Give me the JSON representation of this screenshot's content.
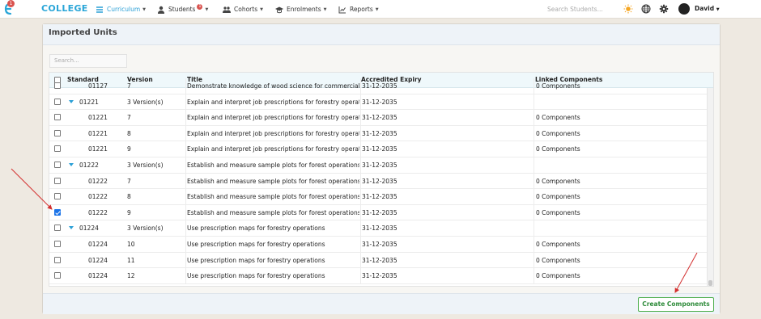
{
  "nav": {
    "brand": "COLLEGE",
    "logo_badge": "1",
    "items": [
      {
        "label": "Curriculum",
        "icon": "list-icon",
        "active": true
      },
      {
        "label": "Students",
        "icon": "user-icon",
        "badge": "1"
      },
      {
        "label": "Cohorts",
        "icon": "group-icon"
      },
      {
        "label": "Enrolments",
        "icon": "graduation-cap-icon"
      },
      {
        "label": "Reports",
        "icon": "chart-line-icon"
      }
    ],
    "search_placeholder": "Search Students...",
    "user": "David",
    "accent_color": "#2aa6d8"
  },
  "panel": {
    "title": "Imported Units",
    "search_placeholder": "Search...",
    "columns": [
      "Standard",
      "Version",
      "Title",
      "Accredited Expiry",
      "Linked Components"
    ],
    "rows": [
      {
        "type": "child",
        "standard": "01127",
        "version": "7",
        "title": "Demonstrate knowledge of wood science for commercial",
        "expiry": "31-12-2035",
        "linked": "0 Components",
        "checked": false,
        "partial": true
      },
      {
        "type": "group",
        "standard": "01221",
        "version": "3 Version(s)",
        "title": "Explain and interpret job prescriptions for forestry operations",
        "expiry": "31-12-2035",
        "linked": "",
        "checked": false
      },
      {
        "type": "child",
        "standard": "01221",
        "version": "7",
        "title": "Explain and interpret job prescriptions for forestry operations",
        "expiry": "31-12-2035",
        "linked": "0 Components",
        "checked": false
      },
      {
        "type": "child",
        "standard": "01221",
        "version": "8",
        "title": "Explain and interpret job prescriptions for forestry operations",
        "expiry": "31-12-2035",
        "linked": "0 Components",
        "checked": false
      },
      {
        "type": "child",
        "standard": "01221",
        "version": "9",
        "title": "Explain and interpret job prescriptions for forestry operations",
        "expiry": "31-12-2035",
        "linked": "0 Components",
        "checked": false
      },
      {
        "type": "group",
        "standard": "01222",
        "version": "3 Version(s)",
        "title": "Establish and measure sample plots for forest operations",
        "expiry": "31-12-2035",
        "linked": "",
        "checked": false
      },
      {
        "type": "child",
        "standard": "01222",
        "version": "7",
        "title": "Establish and measure sample plots for forest operations",
        "expiry": "31-12-2035",
        "linked": "0 Components",
        "checked": false
      },
      {
        "type": "child",
        "standard": "01222",
        "version": "8",
        "title": "Establish and measure sample plots for forest operations",
        "expiry": "31-12-2035",
        "linked": "0 Components",
        "checked": false
      },
      {
        "type": "child",
        "standard": "01222",
        "version": "9",
        "title": "Establish and measure sample plots for forest operations",
        "expiry": "31-12-2035",
        "linked": "0 Components",
        "checked": true
      },
      {
        "type": "group",
        "standard": "01224",
        "version": "3 Version(s)",
        "title": "Use prescription maps for forestry operations",
        "expiry": "31-12-2035",
        "linked": "",
        "checked": false
      },
      {
        "type": "child",
        "standard": "01224",
        "version": "10",
        "title": "Use prescription maps for forestry operations",
        "expiry": "31-12-2035",
        "linked": "0 Components",
        "checked": false
      },
      {
        "type": "child",
        "standard": "01224",
        "version": "11",
        "title": "Use prescription maps for forestry operations",
        "expiry": "31-12-2035",
        "linked": "0 Components",
        "checked": false
      },
      {
        "type": "child",
        "standard": "01224",
        "version": "12",
        "title": "Use prescription maps for forestry operations",
        "expiry": "31-12-2035",
        "linked": "0 Components",
        "checked": false
      }
    ],
    "create_button": "Create Components",
    "button_color": "#4cae4c",
    "annotation_arrow_color": "#d32f2f"
  }
}
